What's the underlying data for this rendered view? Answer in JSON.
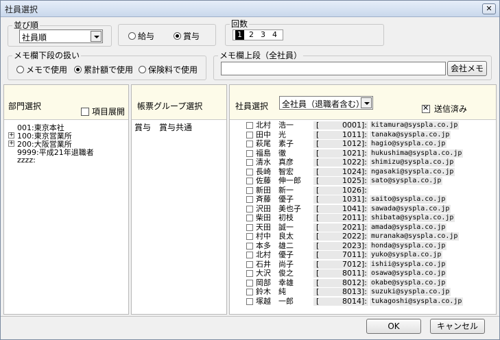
{
  "window": {
    "title": "社員選択",
    "close_label": "✕"
  },
  "sort": {
    "label": "並び順",
    "selected": "社員順"
  },
  "salary_type": {
    "options": [
      {
        "label": "給与",
        "selected": false
      },
      {
        "label": "賞与",
        "selected": true
      }
    ]
  },
  "times": {
    "label": "回数",
    "items": [
      "1",
      "2",
      "3",
      "4"
    ],
    "selected": "1"
  },
  "memo_lower": {
    "label": "メモ欄下段の扱い",
    "options": [
      {
        "label": "メモで使用",
        "selected": false
      },
      {
        "label": "累計額で使用",
        "selected": true
      },
      {
        "label": "保険料で使用",
        "selected": false
      }
    ]
  },
  "memo_upper": {
    "label": "メモ欄上段（全社員）",
    "value": "",
    "button_label": "会社メモ"
  },
  "dept_panel": {
    "title": "部門選択",
    "expand_label": "項目展開",
    "expand_checked": false,
    "tree": [
      {
        "label": "001:東京本社",
        "expandable": false
      },
      {
        "label": "100:東京営業所",
        "expandable": true
      },
      {
        "label": "200:大阪営業所",
        "expandable": true
      },
      {
        "label": "9999:平成21年退職者",
        "expandable": false
      },
      {
        "label": "zzzz:",
        "expandable": false
      }
    ]
  },
  "group_panel": {
    "title": "帳票グループ選択",
    "items": [
      "賞与　賞与共通"
    ]
  },
  "employee_panel": {
    "title": "社員選択",
    "filter_selected": "全社員（退職者含む）",
    "sent_label": "送信済み",
    "sent_checked": true,
    "employees": [
      {
        "name": "北村　浩一",
        "code": "0001",
        "email": "kitamura@syspla.co.jp"
      },
      {
        "name": "田中　光",
        "code": "1011",
        "email": "tanaka@syspla.co.jp"
      },
      {
        "name": "萩尾　素子",
        "code": "1012",
        "email": "hagio@syspla.co.jp"
      },
      {
        "name": "福島　徹",
        "code": "1021",
        "email": "hukushima@syspla.co.jp"
      },
      {
        "name": "清水　真彦",
        "code": "1022",
        "email": "shimizu@syspla.co.jp"
      },
      {
        "name": "長崎　智宏",
        "code": "1024",
        "email": "ngasaki@syspla.co.jp"
      },
      {
        "name": "佐藤　伸一郎",
        "code": "1025",
        "email": "sato@syspla.co.jp"
      },
      {
        "name": "新田　新一",
        "code": "1026",
        "email": ""
      },
      {
        "name": "斉藤　優子",
        "code": "1031",
        "email": "saito@syspla.co.jp"
      },
      {
        "name": "沢田　美也子",
        "code": "1041",
        "email": "sawada@syspla.co.jp"
      },
      {
        "name": "柴田　初枝",
        "code": "2011",
        "email": "shibata@syspla.co.jp"
      },
      {
        "name": "天田　誠一",
        "code": "2021",
        "email": "amada@syspla.co.jp"
      },
      {
        "name": "村中　良太",
        "code": "2022",
        "email": "muranaka@syspla.co.jp"
      },
      {
        "name": "本多　雄二",
        "code": "2023",
        "email": "honda@syspla.co.jp"
      },
      {
        "name": "北村　優子",
        "code": "7011",
        "email": "yuko@syspla.co.jp"
      },
      {
        "name": "石井　尚子",
        "code": "7012",
        "email": "ishii@syspla.co.jp"
      },
      {
        "name": "大沢　俊之",
        "code": "8011",
        "email": "osawa@syspla.co.jp"
      },
      {
        "name": "岡部　幸雄",
        "code": "8012",
        "email": "okabe@syspla.co.jp"
      },
      {
        "name": "鈴木　純",
        "code": "8013",
        "email": "suzuki@syspla.co.jp"
      },
      {
        "name": "塚越　一郎",
        "code": "8014",
        "email": "tukagoshi@syspla.co.jp"
      }
    ]
  },
  "footer": {
    "ok_label": "OK",
    "cancel_label": "キャンセル"
  }
}
